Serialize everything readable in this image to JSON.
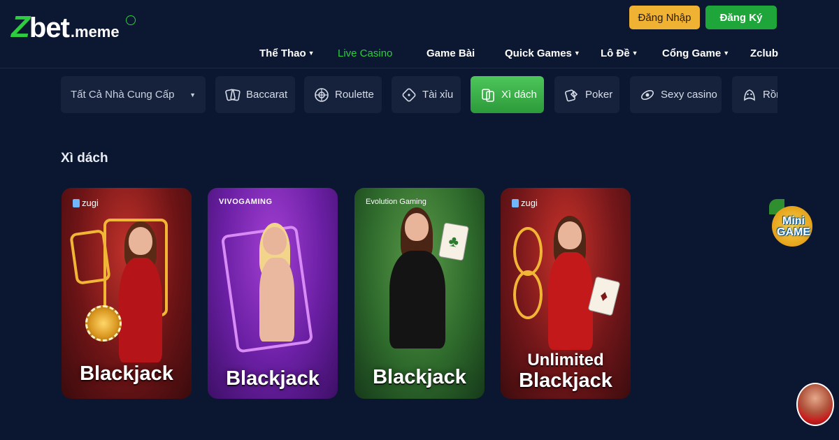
{
  "header": {
    "logo": {
      "brand": "Zbet",
      "z": "Z",
      "rest": "bet",
      "domain": ".meme"
    },
    "login_label": "Đăng Nhập",
    "register_label": "Đăng Ký",
    "nav": [
      {
        "label": "Thể Thao",
        "dropdown": true,
        "active": false
      },
      {
        "label": "Live Casino",
        "dropdown": false,
        "active": true
      },
      {
        "label": "Game Bài",
        "dropdown": false,
        "active": false
      },
      {
        "label": "Quick Games",
        "dropdown": true,
        "active": false
      },
      {
        "label": "Lô Đề",
        "dropdown": true,
        "active": false
      },
      {
        "label": "Cổng Game",
        "dropdown": true,
        "active": false
      },
      {
        "label": "Zclub",
        "dropdown": false,
        "active": false
      }
    ]
  },
  "filters": {
    "provider_select": "Tất Cả Nhà Cung Cấp",
    "chips": [
      {
        "label": "Baccarat",
        "icon": "baccarat-icon",
        "active": false
      },
      {
        "label": "Roulette",
        "icon": "roulette-icon",
        "active": false
      },
      {
        "label": "Tài xỉu",
        "icon": "dice-icon",
        "active": false
      },
      {
        "label": "Xì dách",
        "icon": "blackjack-icon",
        "active": true
      },
      {
        "label": "Poker",
        "icon": "poker-icon",
        "active": false
      },
      {
        "label": "Sexy casino",
        "icon": "sexy-casino-icon",
        "active": false
      },
      {
        "label": "Rồng",
        "icon": "dragon-icon",
        "active": false
      }
    ]
  },
  "section": {
    "title": "Xì dách"
  },
  "games": [
    {
      "provider": "zugi",
      "title_line1": "Blackjack",
      "title_line2": ""
    },
    {
      "provider": "VIVOGAMING",
      "title_line1": "Blackjack",
      "title_line2": ""
    },
    {
      "provider": "Evolution Gaming",
      "title_line1": "Blackjack",
      "title_line2": ""
    },
    {
      "provider": "zugi",
      "title_line1": "Unlimited",
      "title_line2": "Blackjack"
    }
  ],
  "widgets": {
    "mini_game_label_1": "Mini",
    "mini_game_label_2": "GAME"
  },
  "colors": {
    "background": "#0b1630",
    "accent_green": "#2ecc40",
    "login_yellow": "#f0b233",
    "register_green": "#1ea63a"
  }
}
